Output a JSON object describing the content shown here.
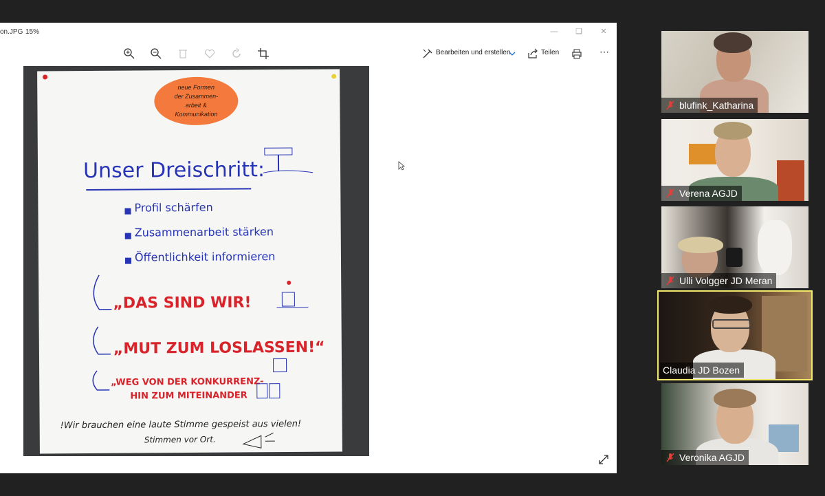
{
  "viewer": {
    "filename": "on.JPG",
    "zoom": "15%",
    "toolbar": {
      "edit_label": "Bearbeiten und erstellen",
      "share_label": "Teilen",
      "more_label": "⋯"
    }
  },
  "poster": {
    "badge_lines": [
      "neue Formen",
      "der Zusammen-",
      "arbeit &",
      "Kommunikation"
    ],
    "heading": "Unser Dreischritt:",
    "steps": [
      "Profil schärfen",
      "Zusammenarbeit stärken",
      "Öffentlichkeit informieren"
    ],
    "slogans": [
      "„DAS SIND WIR!",
      "„MUT ZUM LOSLASSEN!“",
      "„WEG VON DER KONKURRENZ-",
      "HIN ZUM MITEINANDER"
    ],
    "footer_line1": "!Wir brauchen eine laute Stimme gespeist aus vielen!",
    "footer_line2": "Stimmen vor Ort."
  },
  "participants": [
    {
      "name": "blufink_Katharina",
      "muted": true,
      "speaking": false
    },
    {
      "name": "Verena AGJD",
      "muted": true,
      "speaking": false
    },
    {
      "name": "Ulli Volgger JD Meran",
      "muted": true,
      "speaking": false
    },
    {
      "name": "Claudia JD Bozen",
      "muted": false,
      "speaking": true
    },
    {
      "name": "Veronika AGJD",
      "muted": true,
      "speaking": false
    }
  ],
  "colors": {
    "speaking_border": "#f2e96a",
    "mute_icon": "#e0403a",
    "poster_blue": "#2734b5",
    "poster_red": "#d9232a",
    "badge_orange": "#f37a3c"
  }
}
